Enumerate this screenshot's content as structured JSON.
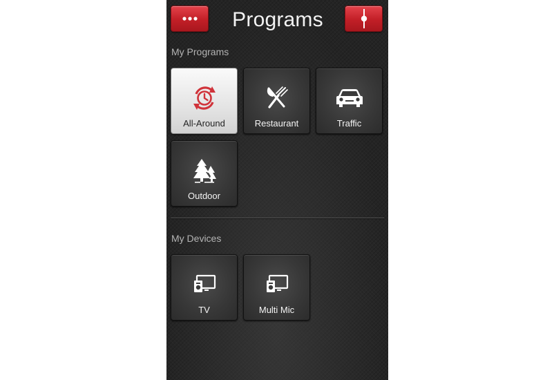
{
  "header": {
    "title": "Programs",
    "menu_icon": "ellipsis-icon",
    "tune_icon": "slider-icon"
  },
  "sections": {
    "programs_label": "My Programs",
    "devices_label": "My Devices"
  },
  "programs": [
    {
      "label": "All-Around",
      "icon": "clock-cycle-icon",
      "active": true
    },
    {
      "label": "Restaurant",
      "icon": "fork-knife-icon",
      "active": false
    },
    {
      "label": "Traffic",
      "icon": "car-icon",
      "active": false
    },
    {
      "label": "Outdoor",
      "icon": "trees-icon",
      "active": false
    }
  ],
  "devices": [
    {
      "label": "TV",
      "icon": "tv-connector-icon"
    },
    {
      "label": "Multi Mic",
      "icon": "microphone-device-icon"
    }
  ],
  "colors": {
    "accent": "#c9252d",
    "background": "#242424",
    "active_tile": "#e8e8e8"
  }
}
